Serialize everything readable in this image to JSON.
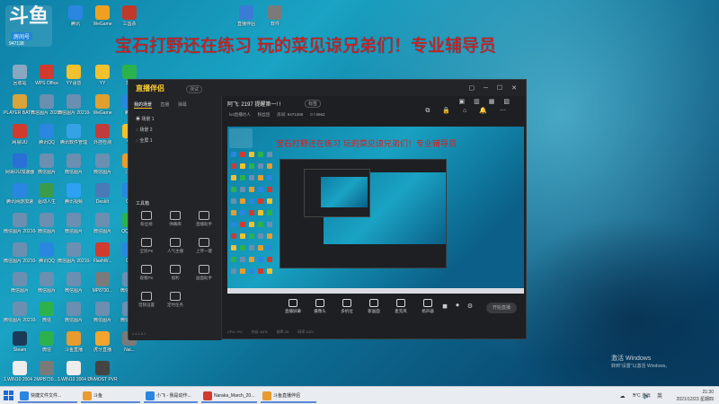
{
  "desktop": {
    "logo": {
      "text": "斗鱼",
      "tag": "房间号",
      "number": "947138"
    },
    "banner": "宝石打野还在练习 玩的菜见谅兄弟们！专业辅导员",
    "top_icons": [
      {
        "label": "腾讯",
        "color": "#2a86e0"
      },
      {
        "label": "WeGame",
        "color": "#f0a020"
      },
      {
        "label": "三国杀",
        "color": "#c0392b"
      },
      {
        "label": "直播伴侣",
        "color": "#3a7bd5"
      },
      {
        "label": "软件",
        "color": "#7a7a7a"
      }
    ],
    "icons": [
      {
        "label": "回收站",
        "color": "#8aa7c2"
      },
      {
        "label": "WPS Office",
        "color": "#d13a2f"
      },
      {
        "label": "YY语音",
        "color": "#f2c12e"
      },
      {
        "label": "YY",
        "color": "#f2c12e"
      },
      {
        "label": "360",
        "color": "#2bb24c"
      },
      {
        "label": "PLAYER BATTLEGR...",
        "color": "#d9a43a"
      },
      {
        "label": "微信图片 2021040...",
        "color": "#6a8fb0"
      },
      {
        "label": "微信图片 2021040...",
        "color": "#6a8fb0"
      },
      {
        "label": "WeGame",
        "color": "#e0a030"
      },
      {
        "label": "腾讯",
        "color": "#2a86e0"
      },
      {
        "label": "网易UU",
        "color": "#d13a2f"
      },
      {
        "label": "腾讯QQ",
        "color": "#2a86e0"
      },
      {
        "label": "腾讯软件管理",
        "color": "#36a2e6"
      },
      {
        "label": "外挂检测",
        "color": "#c23b3b"
      },
      {
        "label": "YY",
        "color": "#f2c12e"
      },
      {
        "label": "网易UU加速器",
        "color": "#2a6fd6"
      },
      {
        "label": "微信图片",
        "color": "#6a8fb0"
      },
      {
        "label": "微信图片",
        "color": "#6a8fb0"
      },
      {
        "label": "微信图片",
        "color": "#6a8fb0"
      },
      {
        "label": "斗鱼",
        "color": "#e89b2e"
      },
      {
        "label": "腾讯网游加速",
        "color": "#2a86e0"
      },
      {
        "label": "驱动人生",
        "color": "#3a9b4a"
      },
      {
        "label": "腾讯视频",
        "color": "#2ea1f2"
      },
      {
        "label": "DeskIt",
        "color": "#4a79b8"
      },
      {
        "label": "QQ",
        "color": "#2a86e0"
      },
      {
        "label": "微信图片 2021040...",
        "color": "#6a8fb0"
      },
      {
        "label": "微信图片",
        "color": "#6a8fb0"
      },
      {
        "label": "微信图片",
        "color": "#6a8fb0"
      },
      {
        "label": "微信图片",
        "color": "#6a8fb0"
      },
      {
        "label": "QQ音乐",
        "color": "#2bb24c"
      },
      {
        "label": "微信图片 2021040...",
        "color": "#6a8fb0"
      },
      {
        "label": "腾讯QQ",
        "color": "#2a86e0"
      },
      {
        "label": "微信图片 2021040...",
        "color": "#6a8fb0"
      },
      {
        "label": "FlashW...",
        "color": "#d13a2f"
      },
      {
        "label": "QQ",
        "color": "#2a86e0"
      },
      {
        "label": "微信图片",
        "color": "#6a8fb0"
      },
      {
        "label": "微信图片",
        "color": "#6a8fb0"
      },
      {
        "label": "微信图片",
        "color": "#6a8fb0"
      },
      {
        "label": "MP8730...",
        "color": "#7a7a7a"
      },
      {
        "label": "微信图片",
        "color": "#6a8fb0"
      },
      {
        "label": "微信图片 2021040...",
        "color": "#6a8fb0"
      },
      {
        "label": "微信",
        "color": "#2bb24c"
      },
      {
        "label": "微信图片",
        "color": "#6a8fb0"
      },
      {
        "label": "微信图片",
        "color": "#6a8fb0"
      },
      {
        "label": "微信图片",
        "color": "#6a8fb0"
      },
      {
        "label": "Steam",
        "color": "#1b3a5a"
      },
      {
        "label": "微信",
        "color": "#2bb24c"
      },
      {
        "label": "斗鱼直播",
        "color": "#e89b2e"
      },
      {
        "label": "虎牙直播",
        "color": "#f2a42e"
      },
      {
        "label": "Nai...",
        "color": "#7a7a7a"
      },
      {
        "label": "1.WIN10 2004 20H...",
        "color": "#ededed"
      },
      {
        "label": "MPB730...",
        "color": "#7a7a7a"
      },
      {
        "label": "1.WIN10 2004 20H...",
        "color": "#ededed"
      },
      {
        "label": "UNMOST PVR",
        "color": "#444"
      }
    ],
    "activation": {
      "title": "激活 Windows",
      "subtitle": "转到\"设置\"以激活 Windows。"
    }
  },
  "app": {
    "logo": "直播伴侣",
    "beta": "测试",
    "tabs": [
      "我的场景",
      "直播",
      "弹幕"
    ],
    "scenes": [
      "场景 1",
      "场景 2",
      "全屏 1"
    ],
    "tools_title": "工具箱",
    "tools": [
      {
        "label": "粉丝榜"
      },
      {
        "label": "弹幕库"
      },
      {
        "label": "直播助手"
      },
      {
        "label": "全民PK"
      },
      {
        "label": "人气主播"
      },
      {
        "label": "上传一键"
      },
      {
        "label": "观看PK"
      },
      {
        "label": "福利"
      },
      {
        "label": "画面助手"
      },
      {
        "label": "音频设置"
      },
      {
        "label": "定时任务"
      }
    ],
    "header": {
      "title": "阿飞: 2197 提醒第一! !",
      "badge": "标签",
      "sub": [
        "lv4直播达人",
        "粉丝团",
        "房间: 9471388",
        "0 / 0662"
      ]
    },
    "preview_banner": "宝石打野还在练习 玩的菜见谅兄弟们！专业辅导员",
    "controls": [
      {
        "label": "直播屏幕"
      },
      {
        "label": "摄像头"
      },
      {
        "label": "多机位"
      },
      {
        "label": "新画面"
      },
      {
        "label": "麦克风"
      },
      {
        "label": "扬声器"
      }
    ],
    "go_live": "开始直播",
    "status": [
      "CPU: 9%",
      "内存: 64%",
      "帧率 25",
      "码率 4321"
    ]
  },
  "taskbar": {
    "items": [
      {
        "label": "快捷文件文件...",
        "color": "#2a86e0"
      },
      {
        "label": "斗鱼",
        "color": "#e89b2e"
      },
      {
        "label": "小飞 - 我是动作...",
        "color": "#2a86e0"
      },
      {
        "label": "Naraka_March_20...",
        "color": "#d13a2f"
      },
      {
        "label": "斗鱼直播伴侣",
        "color": "#e89b2e"
      }
    ],
    "weather": "5°C 多云",
    "time": "21:30",
    "date": "2021/12/23 星期四"
  }
}
